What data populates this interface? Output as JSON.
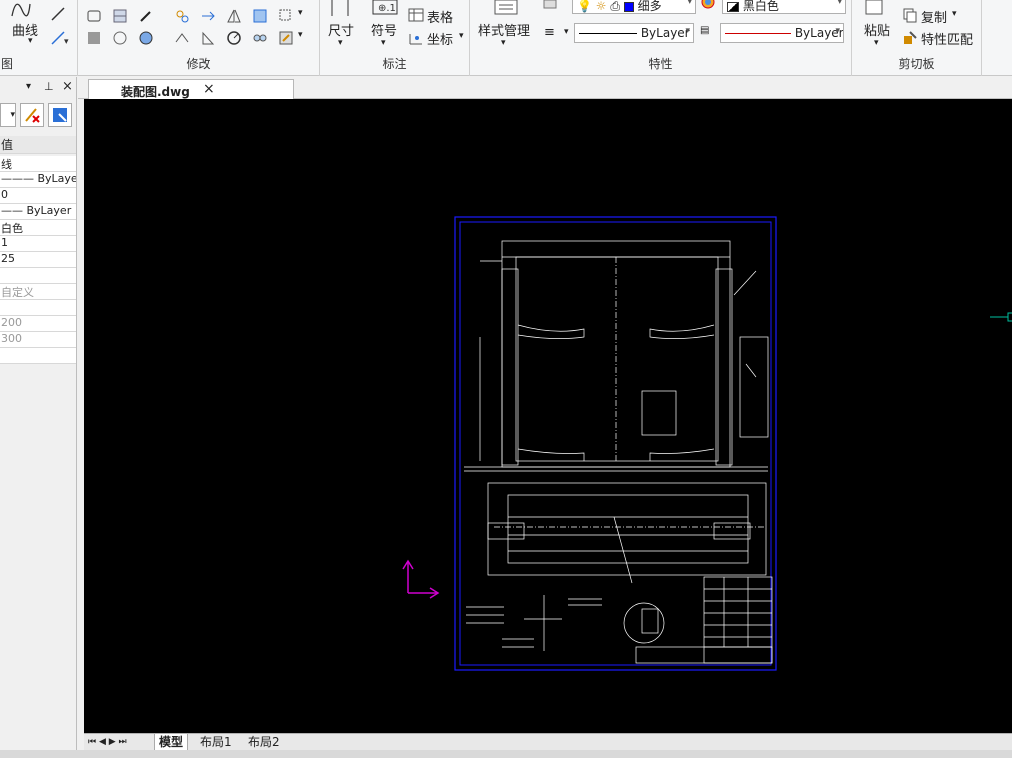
{
  "ribbon": {
    "draw": {
      "curve_label": "曲线",
      "group_label": "图"
    },
    "modify": {
      "group_label": "修改"
    },
    "annotation": {
      "dimension_label": "尺寸",
      "symbol_label": "符号",
      "table_label": "表格",
      "coordinate_label": "坐标",
      "group_label": "标注"
    },
    "properties": {
      "style_manager_label": "样式管理",
      "lineweight_value": "细多",
      "color_value": "黑白色",
      "linetype_value": "ByLayer",
      "lineweight2_value": "ByLayer",
      "group_label": "特性"
    },
    "clipboard": {
      "paste_label": "粘贴",
      "copy_label": "复制",
      "match_props_label": "特性匹配",
      "group_label": "剪切板"
    }
  },
  "palette": {
    "header": "值",
    "rows": [
      {
        "text": "线",
        "gray": false
      },
      {
        "text": "——— ByLayer",
        "gray": false
      },
      {
        "text": "0",
        "gray": false
      },
      {
        "text": "—— ByLayer",
        "gray": false
      },
      {
        "text": "白色",
        "gray": false
      },
      {
        "text": "1",
        "gray": false
      },
      {
        "text": "25",
        "gray": false
      },
      {
        "text": "",
        "gray": false
      },
      {
        "text": "自定义",
        "gray": true
      },
      {
        "text": "",
        "gray": true
      },
      {
        "text": "200",
        "gray": true
      },
      {
        "text": "300",
        "gray": true
      },
      {
        "text": "",
        "gray": false
      }
    ]
  },
  "document": {
    "tab_title": "装配图.dwg",
    "close_glyph": "×"
  },
  "layouts": {
    "nav": "⏮ ◀ ▶ ⏭",
    "model": "模型",
    "layout1": "布局1",
    "layout2": "布局2"
  },
  "colors": {
    "canvas_bg": "#000000",
    "frame": "#1a1aff",
    "ucs": "#d000d0",
    "lines": "#ffffff"
  }
}
